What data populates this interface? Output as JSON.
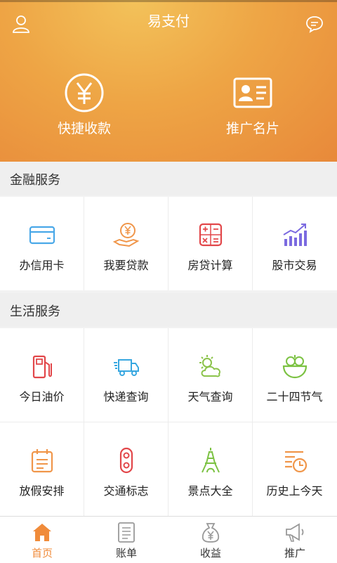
{
  "header": {
    "title": "易支付",
    "actions": [
      {
        "label": "快捷收款",
        "icon": "yen-circle-icon"
      },
      {
        "label": "推广名片",
        "icon": "id-card-icon"
      }
    ]
  },
  "sections": [
    {
      "title": "金融服务",
      "items": [
        {
          "label": "办信用卡",
          "icon": "credit-card-icon"
        },
        {
          "label": "我要贷款",
          "icon": "loan-hand-icon"
        },
        {
          "label": "房贷计算",
          "icon": "calculator-icon"
        },
        {
          "label": "股市交易",
          "icon": "stock-chart-icon"
        }
      ]
    },
    {
      "title": "生活服务",
      "items": [
        {
          "label": "今日油价",
          "icon": "fuel-pump-icon"
        },
        {
          "label": "快递查询",
          "icon": "delivery-truck-icon"
        },
        {
          "label": "天气查询",
          "icon": "weather-icon"
        },
        {
          "label": "二十四节气",
          "icon": "vegetable-bowl-icon"
        },
        {
          "label": "放假安排",
          "icon": "calendar-icon"
        },
        {
          "label": "交通标志",
          "icon": "traffic-light-icon"
        },
        {
          "label": "景点大全",
          "icon": "tower-icon"
        },
        {
          "label": "历史上今天",
          "icon": "history-clock-icon"
        }
      ]
    }
  ],
  "tabs": [
    {
      "label": "首页",
      "icon": "home-icon",
      "active": true
    },
    {
      "label": "账单",
      "icon": "bill-icon",
      "active": false
    },
    {
      "label": "收益",
      "icon": "money-bag-icon",
      "active": false
    },
    {
      "label": "推广",
      "icon": "megaphone-icon",
      "active": false
    }
  ],
  "colors": {
    "accent": "#f08b3a",
    "header_top": "#f3c25a",
    "header_bottom": "#e8893a"
  }
}
